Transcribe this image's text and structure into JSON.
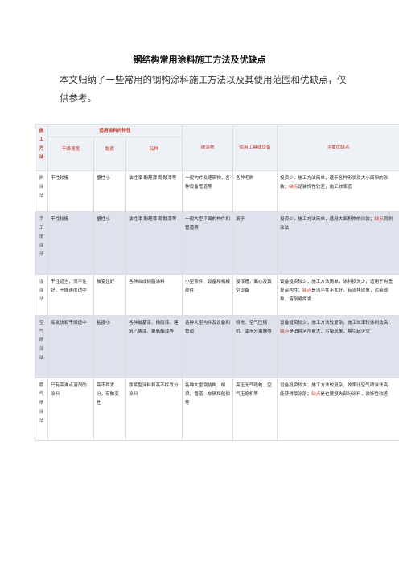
{
  "doc": {
    "title": "钢结构常用涂料施工方法及优缺点",
    "intro": "本文归纳了一些常用的钢构涂料施工方法以及其使用范围和优缺点，仅供参考。"
  },
  "table": {
    "headers": {
      "method": "施工方法",
      "group": "适用涂料的特性",
      "dry": "干燥速度",
      "viscosity": "黏度",
      "variety": "品种",
      "objects": "被涂物",
      "tools": "使用工具或设备",
      "pros_cons": "主要优缺点"
    },
    "rows": [
      {
        "method": "刷涂法",
        "dry": "干性较慢",
        "viscosity": "塑性小",
        "variety": "油性漆 酚醛漆 醇酸漆等",
        "objects": "一般构件及建筑物，各种设备管道等",
        "tools": "各种毛刷",
        "pc_before": "投资少，施工方法简单，适于各种形状及大小面积的涂装；",
        "pc_red": "缺点",
        "pc_after": "是装饰性较差，施工效率低"
      },
      {
        "method": "手工滚涂法",
        "dry": "干性较慢",
        "viscosity": "塑性小",
        "variety": "油性漆 酚醛漆 醇酸漆等",
        "objects": "一般大型平面的构件和管道等",
        "tools": "滚子",
        "pc_before": "投资少，施工方法简单，适用大面积物的涂装；",
        "pc_red": "缺点",
        "pc_after": "同刷涂法"
      },
      {
        "method": "浸涂法",
        "dry": "干性适当，流平性好，干燥速度适中",
        "viscosity": "触变性好",
        "variety": "各种合成树脂涂料",
        "objects": "小型零件、设备和机械部件",
        "tools": "浸漆槽，离心及真空设备",
        "pc_before": "设备投资较少，施工方法简单，涂料损失少，适用于构造复杂构件；",
        "pc_red": "缺点",
        "pc_after": "是流平性不太好，有流挂现象，污染现象，溶剂易挥发"
      },
      {
        "method": "空气喷涂法",
        "dry": "挥发快和干燥适中",
        "viscosity": "粘度小",
        "variety": "各种硝基漆、橡胶漆、建筑乙烯漆、聚氨酯漆等",
        "objects": "各种大型构件及设备和管道",
        "tools": "喷枪、空气压缩机、油水分离器等",
        "pc_before": "设备投资较少，施工方法较复杂，施工效率较涂刷法高；",
        "pc_red": "缺点",
        "pc_after": "是消耗溶剂量大，污染现象，易引起火灾"
      },
      {
        "method": "雾气喷涂法",
        "dry": "只有高沸点溶剂的涂料",
        "viscosity": "高不挥发分，有触变性",
        "variety": "厚浆型涂料和高不挥发分涂料",
        "objects": "各种大型钢结构、桥梁、管道、车辆和船舶等",
        "tools": "高压无气喷枪、空气压缩机等",
        "pc_before": "设备投资较大，施工方法较复杂，效率比空气喷涂法高，能获得厚涂层；",
        "pc_red": "缺点",
        "pc_after": "是也要损失部分涂料，装饰性较差"
      }
    ]
  }
}
